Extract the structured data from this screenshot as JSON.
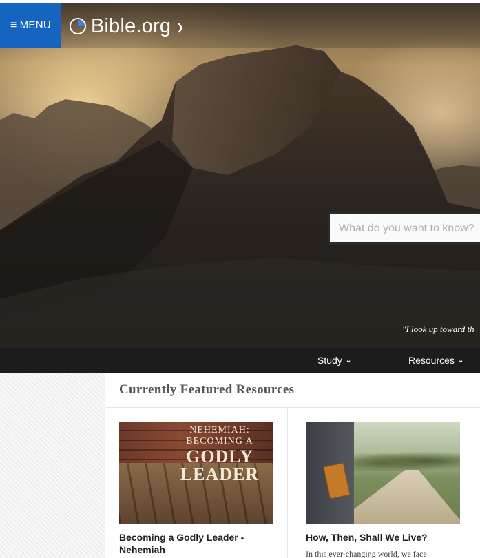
{
  "header": {
    "menu_label": "MENU",
    "logo_text": "Bible.org",
    "icons": {
      "menu": "hamburger-icon",
      "logo": "circle-logo-icon",
      "dropdown": "chevron-down-icon"
    }
  },
  "hero": {
    "search_placeholder": "What do you want to know?",
    "quote": "\"I look up toward th"
  },
  "nav": {
    "items": [
      {
        "label": "Study"
      },
      {
        "label": "Resources"
      }
    ]
  },
  "featured": {
    "title": "Currently Featured Resources",
    "cards": [
      {
        "title": "Becoming a Godly Leader - Nehemiah",
        "image_text": [
          "NEHEMIAH:",
          "BECOMING A",
          "GODLY",
          "LEADER"
        ],
        "description": ""
      },
      {
        "title": "How, Then, Shall We Live?",
        "description": "In this ever-changing world, we face"
      }
    ]
  },
  "colors": {
    "menu_bg": "#1565c0",
    "nav_bg": "#1c1c1c"
  }
}
